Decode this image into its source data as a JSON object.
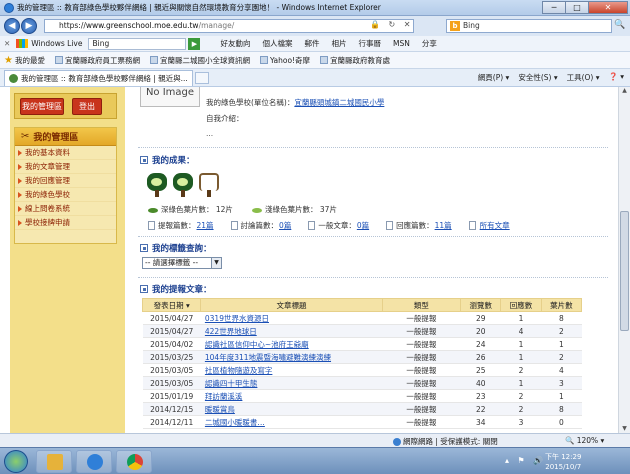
{
  "window": {
    "title": "我的管理區 :: 教育部綠色學校夥伴網絡 | 親近與關懷自然環境教育分享園地！ - Windows Internet Explorer",
    "min": "─",
    "max": "□",
    "close": "✕"
  },
  "address": {
    "protocol": "https://",
    "host": "www.greenschool.moe.edu.tw",
    "path": "/manage/",
    "icons": "🔒 ↻ ✕"
  },
  "search": {
    "provider": "Bing",
    "value": "Bing",
    "go": "🔍"
  },
  "wl_bar": {
    "close": "✕",
    "name": "Windows Live",
    "input": "Bing",
    "links": [
      "好友動向",
      "個人檔案",
      "郵件",
      "相片",
      "行事曆",
      "MSN",
      "分享"
    ]
  },
  "favorites": {
    "label": "我的最愛",
    "items": [
      "宜蘭縣政府員工票務網",
      "宜蘭縣二城國小全球資訊網",
      "Yahoo!奇摩",
      "宜蘭縣政府教育處"
    ]
  },
  "tab": {
    "title": "我的管理區 :: 教育部綠色學校夥伴網絡 | 親近與..."
  },
  "commands": [
    "網頁(P) ▾",
    "安全性(S) ▾",
    "工具(O) ▾",
    "❓ ▾"
  ],
  "left": {
    "manage_button": "我的管理區",
    "logout_button": "登出",
    "panel_title": "我的管理區",
    "menu": [
      "我的基本資料",
      "我的文章管理",
      "我的回應管理",
      "我的綠色學校",
      "線上問卷系統",
      "學校接牌申請"
    ]
  },
  "profile": {
    "no_image": "No Image",
    "school_label": "我的綠色學校(單位名稱)：",
    "school_name": "宜蘭縣頭城鎮二城國民小學",
    "intro_label": "自我介紹：",
    "intro_value": "..."
  },
  "achievements": {
    "heading": "我的成果：",
    "deep_leaf_label": "深綠色葉片數：",
    "deep_leaf_value": "12片",
    "light_leaf_label": "淺綠色葉片數：",
    "light_leaf_value": "37片",
    "stats": [
      {
        "label": "提報篇數：",
        "value": "21篇"
      },
      {
        "label": "討論篇數：",
        "value": "0篇"
      },
      {
        "label": "一般文章：",
        "value": "0篇"
      },
      {
        "label": "回應篇數：",
        "value": "11篇"
      },
      {
        "label": "",
        "value": "所有文章"
      }
    ]
  },
  "tags": {
    "heading": "我的標籤查詢：",
    "select_value": "-- 請選擇標籤 --"
  },
  "posts": {
    "heading": "我的提報文章：",
    "columns": [
      "發表日期 ▾",
      "文章標題",
      "類型",
      "瀏覽數",
      "回應數",
      "葉片數"
    ],
    "rows": [
      [
        "2015/04/27",
        "0319世界水資源日",
        "一般提報",
        "29",
        "1",
        "8"
      ],
      [
        "2015/04/27",
        "422世界地球日",
        "一般提報",
        "20",
        "4",
        "2"
      ],
      [
        "2015/04/02",
        "認識社區信仰中心~池府王爺廟",
        "一般提報",
        "24",
        "1",
        "1"
      ],
      [
        "2015/03/25",
        "104年度311地震暨海嘯避難演練演練",
        "一般提報",
        "26",
        "1",
        "2"
      ],
      [
        "2015/03/05",
        "社區植物隨遊及寫字",
        "一般提報",
        "25",
        "2",
        "4"
      ],
      [
        "2015/03/05",
        "認識四十甲生態",
        "一般提報",
        "40",
        "1",
        "3"
      ],
      [
        "2015/01/19",
        "拜訪蘭溪溪",
        "一般提報",
        "23",
        "2",
        "1"
      ],
      [
        "2014/12/15",
        "暖暖賞鳥",
        "一般提報",
        "22",
        "2",
        "8"
      ],
      [
        "2014/12/11",
        "二城國小暖暖書…",
        "一般提報",
        "34",
        "3",
        "0"
      ]
    ]
  },
  "status": {
    "zone": "網際網路 | 受保護模式: 關閉",
    "zoom": "🔍 120% ▾"
  },
  "taskbar": {
    "time": "下午 12:29",
    "date": "2015/10/7",
    "tray": "▴ ⚑ 🔊"
  }
}
